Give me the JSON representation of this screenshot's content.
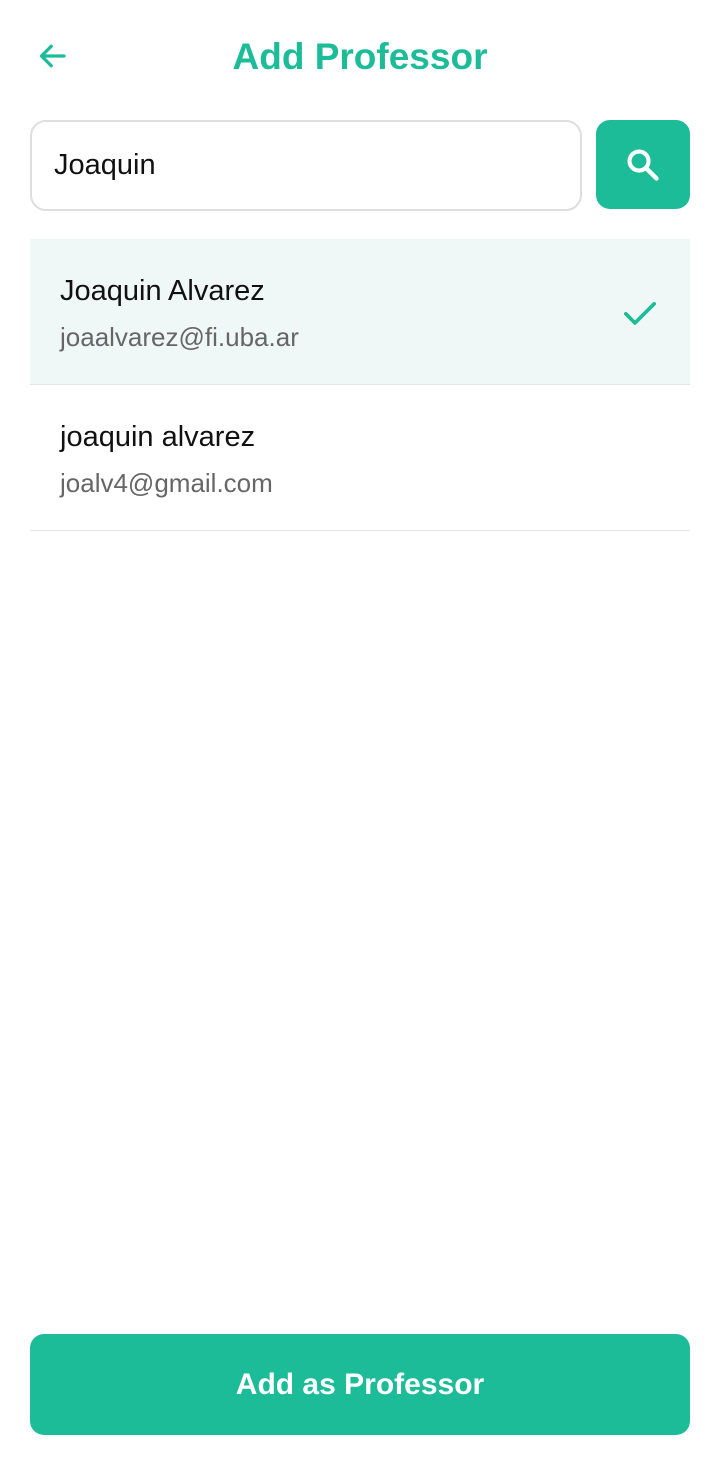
{
  "header": {
    "title": "Add Professor",
    "back_icon": "arrow-left-icon"
  },
  "search": {
    "value": "Joaquin",
    "placeholder": "",
    "button_icon": "search-icon"
  },
  "results": [
    {
      "name": "Joaquin Alvarez",
      "email": "joaalvarez@fi.uba.ar",
      "selected": true
    },
    {
      "name": "joaquin alvarez",
      "email": "joalv4@gmail.com",
      "selected": false
    }
  ],
  "footer": {
    "add_button_label": "Add as Professor"
  },
  "colors": {
    "accent": "#1cbc99",
    "selected_row_bg": "#eff8f6",
    "primary_text": "#111111",
    "secondary_text": "#666666",
    "divider": "#e6e6e6"
  }
}
